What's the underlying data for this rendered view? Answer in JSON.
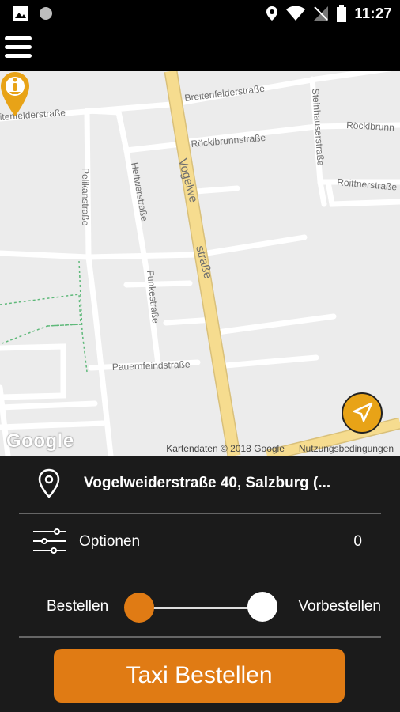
{
  "status_bar": {
    "time": "11:27"
  },
  "app_bar": {
    "menu_icon": "hamburger-menu-icon"
  },
  "map": {
    "streets": {
      "breitenfelder_1": "Breitenfelderstraße",
      "breitenfelder_2": "itenfelderstraße",
      "rocklbrunn_1": "Röcklbrunnstraße",
      "rocklbrunn_2": "Röcklbrunn",
      "steinhauser": "Steinhauserstraße",
      "roittner": "Roittnerstraße",
      "pelikan": "Pelikanstraße",
      "hettwer": "Hettwerstraße",
      "funke": "Funkestraße",
      "vogelweider_a": "Vogelwe",
      "vogelweider_b": "straße",
      "pauernfeind": "Pauernfeindstraße"
    },
    "google_logo": "Google",
    "attribution": "Kartendaten © 2018 Google",
    "terms": "Nutzungsbedingungen",
    "accent": "#e8a317"
  },
  "panel": {
    "address": "Vogelweiderstraße 40, Salzburg (...",
    "options_label": "Optionen",
    "options_count": "0",
    "toggle_left": "Bestellen",
    "toggle_right": "Vorbestellen",
    "order_button": "Taxi Bestellen",
    "accent": "#e07b14"
  }
}
